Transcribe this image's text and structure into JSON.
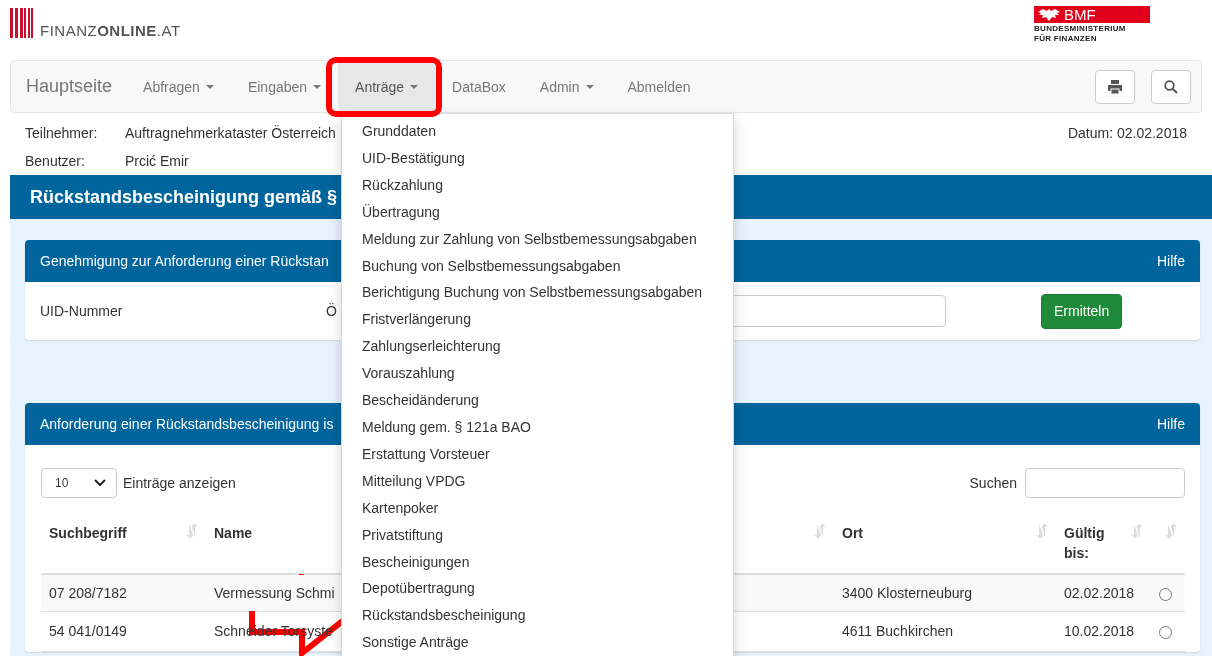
{
  "header": {
    "logo_text": "FINANZ**ONLINE**.AT",
    "ministry": {
      "badge": "BMF",
      "line_1": "BUNDESMINISTERIUM",
      "line_2": "FÜR FINANZEN"
    }
  },
  "nav": {
    "brand": "Hauptseite",
    "items": [
      {
        "label": "Abfragen",
        "has_caret": true,
        "selected": false
      },
      {
        "label": "Eingaben",
        "has_caret": true,
        "selected": false
      },
      {
        "label": "Anträge",
        "has_caret": true,
        "selected": true
      },
      {
        "label": "DataBox",
        "has_caret": false,
        "selected": false
      },
      {
        "label": "Admin",
        "has_caret": true,
        "selected": false
      },
      {
        "label": "Abmelden",
        "has_caret": false,
        "selected": false
      }
    ]
  },
  "dropdown": {
    "items": [
      "Grunddaten",
      "UID-Bestätigung",
      "Rückzahlung",
      "Übertragung",
      "Meldung zur Zahlung von Selbstbemessungsabgaben",
      "Buchung von Selbstbemessungsabgaben",
      "Berichtigung Buchung von Selbstbemessungsabgaben",
      "Fristverlängerung",
      "Zahlungserleichterung",
      "Vorauszahlung",
      "Bescheidänderung",
      "Meldung gem. § 121a BAO",
      "Erstattung Vorsteuer",
      "Mitteilung VPDG",
      "Kartenpoker",
      "Privatstiftung",
      "Bescheinigungen",
      "Depotübertragung",
      "Rückstandsbescheinigung",
      "Sonstige Anträge"
    ]
  },
  "info": {
    "participant_label": "Teilnehmer:",
    "participant": "Auftragnehmerkataster Österreich",
    "user_label": "Benutzer:",
    "user": "Prcić Emir",
    "date": "Datum: 02.02.2018"
  },
  "page_title": "Rückstandsbescheinigung gemäß §",
  "panel_1": {
    "title": "Genehmigung zur Anforderung einer Rückstan",
    "help": "Hilfe",
    "field_label": "UID-Nummer",
    "field_label_2": "Ö",
    "button": "Ermitteln"
  },
  "panel_2": {
    "title": "Anforderung einer Rückstandsbescheinigung is",
    "help": "Hilfe",
    "page_size": "10",
    "page_size_label": "Einträge anzeigen",
    "search_label": "Suchen",
    "table": {
      "columns": [
        {
          "label": "Suchbegriff",
          "sortable": true
        },
        {
          "label": "Name",
          "sortable": true
        },
        {
          "label": "Ort",
          "sortable": true
        },
        {
          "label": "Gültig bis:",
          "sortable": true
        },
        {
          "sortable": true
        }
      ],
      "rows": [
        {
          "suchbegriff": "07 208/7182",
          "name": "Vermessung Schmi",
          "ort": "3400 Klosterneuburg",
          "gueltig_bis": "02.02.2018",
          "selected": false
        },
        {
          "suchbegriff": "54 041/0149",
          "name": "Schneider Torsyste",
          "ort": "4611 Buchkirchen",
          "gueltig_bis": "10.02.2018",
          "selected": false
        }
      ]
    }
  }
}
